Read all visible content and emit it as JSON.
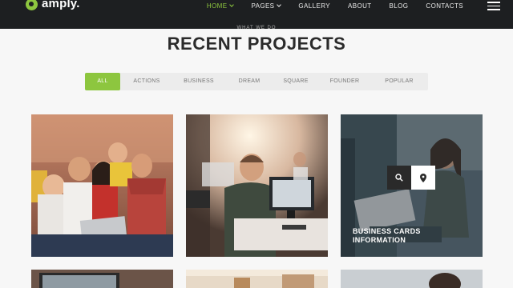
{
  "brand": {
    "name": "amply.",
    "accent": "#8dc63f"
  },
  "nav": {
    "items": [
      {
        "label": "HOME",
        "active": true,
        "dropdown": true
      },
      {
        "label": "PAGES",
        "active": false,
        "dropdown": true
      },
      {
        "label": "GALLERY",
        "active": false,
        "dropdown": false
      },
      {
        "label": "ABOUT",
        "active": false,
        "dropdown": false
      },
      {
        "label": "BLOG",
        "active": false,
        "dropdown": false
      },
      {
        "label": "CONTACTS",
        "active": false,
        "dropdown": false
      }
    ],
    "menu_icon": "hamburger-icon"
  },
  "section": {
    "eyebrow": "WHAT WE DO",
    "title_light": "RECENT ",
    "title_bold": "PROJECTS"
  },
  "filters": [
    "ALL",
    "ACTIONS",
    "BUSINESS",
    "DREAM",
    "SQUARE",
    "FOUNDER",
    "POPULAR"
  ],
  "active_filter": "ALL",
  "projects": [
    {
      "image": "friends-on-couch-photo"
    },
    {
      "image": "office-workers-photo"
    },
    {
      "image": "woman-with-laptop-photo",
      "caption": "BUSINESS CARDS INFORMATION",
      "hover": true,
      "icons": [
        "search-icon",
        "map-pin-icon"
      ]
    },
    {
      "image": "laptop-desk-photo"
    },
    {
      "image": "office-window-photo"
    },
    {
      "image": "woman-portrait-photo"
    }
  ]
}
